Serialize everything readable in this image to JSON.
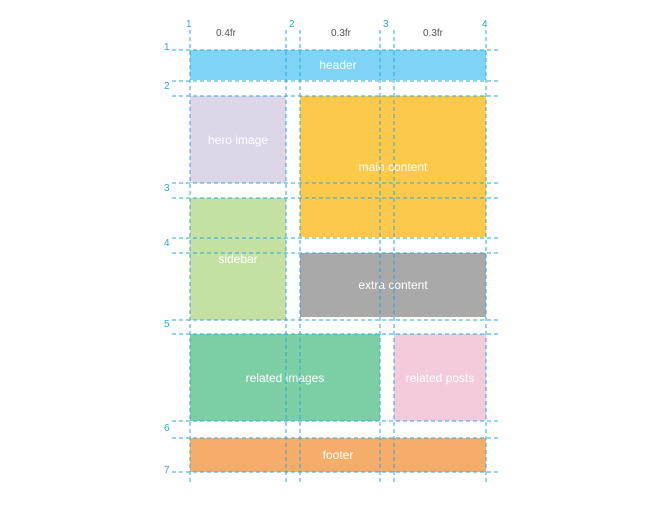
{
  "colors": {
    "header": "#7fd3f7",
    "hero_image": "#ddd5e8",
    "main_content": "#fdc94a",
    "sidebar": "#c5e0a3",
    "extra_content": "#a9a9a9",
    "related_images": "#7ccfa4",
    "related_posts": "#f4cbdc",
    "footer": "#f7ad6a",
    "grid_line": "#2aa8d8"
  },
  "columns": {
    "numbers": [
      "1",
      "2",
      "3",
      "4"
    ],
    "sizes": [
      "0.4fr",
      "0.3fr",
      "0.3fr"
    ]
  },
  "rows": {
    "numbers": [
      "1",
      "2",
      "3",
      "4",
      "5",
      "6",
      "7"
    ]
  },
  "areas": {
    "header": "header",
    "hero_image": "hero image",
    "main_content": "main content",
    "sidebar": "sidebar",
    "extra_content": "extra content",
    "related_images": "related images",
    "related_posts": "related posts",
    "footer": "footer"
  }
}
